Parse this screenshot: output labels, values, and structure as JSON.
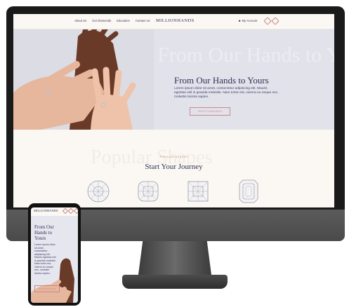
{
  "nav": {
    "links": [
      "About Us",
      "Our Diamonds",
      "Education",
      "Contact Us"
    ],
    "logo": "MILLIONHANDS",
    "account": "My Account"
  },
  "hero": {
    "ghost_text": "From Our Hands to Yours",
    "title": "From Our Hands to Yours",
    "body": "Lorem ipsum dolor sit amet, consectetur adipiscing elit. Mauris egestas nisl in gravida molestie. Nam tortor est, viverra eu neque nec, molestie lacinia sapien.",
    "button": "SHOP DIAMONDS"
  },
  "journey": {
    "eyebrow": "POPULAR SHAPES",
    "ghost_text": "Popular Shapes",
    "title": "Start Your Journey",
    "shapes": [
      "round-diamond-icon",
      "cushion-diamond-icon",
      "princess-diamond-icon",
      "emerald-diamond-icon"
    ]
  },
  "mobile": {
    "logo": "MILLIONHANDS",
    "title": "From Our Hands to Yours",
    "body": "Lorem ipsum dolor sit amet, consectetur adipiscing elit. Mauris egestas nisl in gravida molestie. Nam tortor est, viverra eu neque nec, molestie lacinia sapien.",
    "button": "SHOP DIAMONDS"
  },
  "colors": {
    "navy": "#2f3258",
    "rose": "#c98a8a",
    "cream": "#fbf8f3",
    "hero_bg": "#e2e2ea"
  }
}
